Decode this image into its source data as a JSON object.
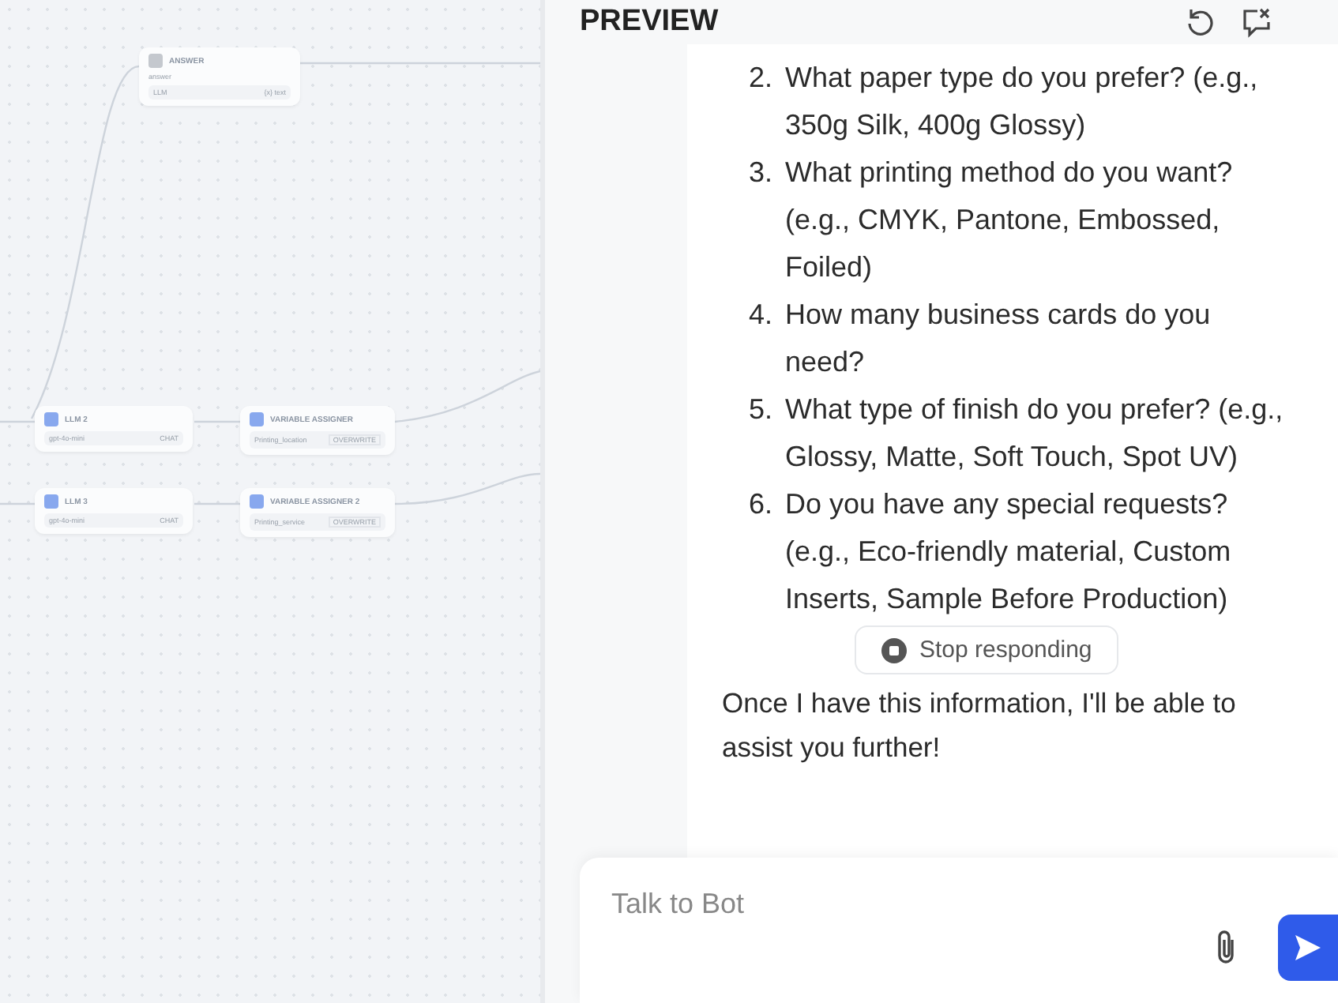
{
  "canvas": {
    "answer_node": {
      "title": "ANSWER",
      "label": "answer",
      "source": "LLM",
      "variable": "{x} text"
    },
    "rows": [
      {
        "llm": {
          "title": "LLM 2",
          "model": "gpt-4o-mini",
          "mode": "CHAT"
        },
        "assigner": {
          "title": "VARIABLE ASSIGNER",
          "variable": "Printing_location",
          "operation": "OVERWRITE"
        }
      },
      {
        "llm": {
          "title": "LLM 3",
          "model": "gpt-4o-mini",
          "mode": "CHAT"
        },
        "assigner": {
          "title": "VARIABLE ASSIGNER 2",
          "variable": "Printing_service",
          "operation": "OVERWRITE"
        }
      }
    ]
  },
  "preview": {
    "title": "PREVIEW",
    "items": [
      {
        "number": "2.",
        "text": "What paper type do you prefer? (e.g., 350g Silk, 400g Glossy)"
      },
      {
        "number": "3.",
        "text": "What printing method do you want? (e.g., CMYK, Pantone, Embossed, Foiled)"
      },
      {
        "number": "4.",
        "text": "How many business cards do you need?"
      },
      {
        "number": "5.",
        "text": "What type of finish do you prefer? (e.g., Glossy, Matte, Soft Touch, Spot UV)"
      },
      {
        "number": "6.",
        "text": "Do you have any special requests? (e.g., Eco-friendly material, Custom Inserts, Sample Before Production)"
      }
    ],
    "stop_button": "Stop responding",
    "closing": "Once I have this information, I'll be able to assist you further!",
    "input": {
      "placeholder": "Talk to Bot"
    }
  }
}
